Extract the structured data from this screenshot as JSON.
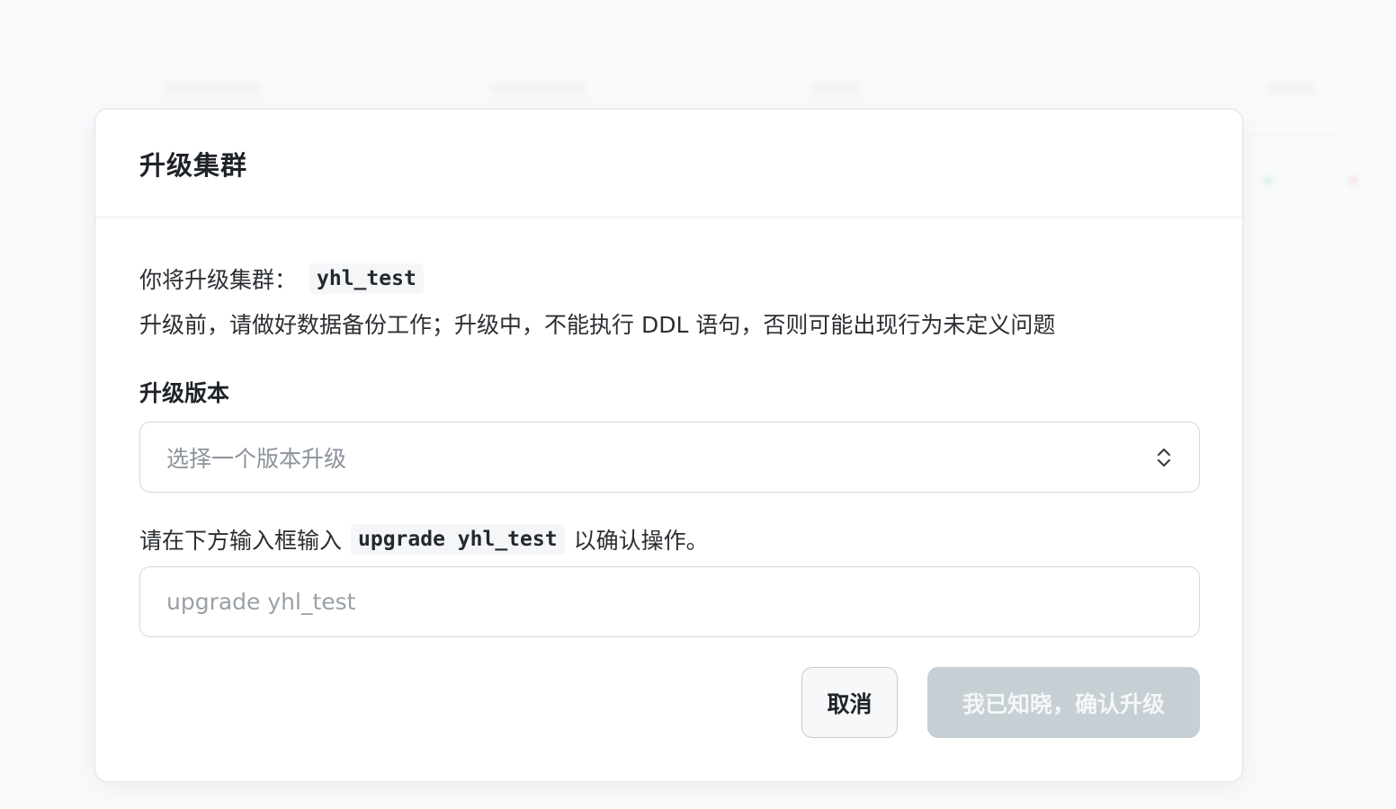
{
  "dialog": {
    "title": "升级集群",
    "intro_prefix": "你将升级集群：",
    "cluster_name": "yhl_test",
    "warning": "升级前，请做好数据备份工作；升级中，不能执行 DDL 语句，否则可能出现行为未定义问题",
    "version_label": "升级版本",
    "version_select": {
      "placeholder": "选择一个版本升级",
      "value": ""
    },
    "confirm_prompt_prefix": "请在下方输入框输入",
    "confirm_phrase": "upgrade yhl_test",
    "confirm_prompt_suffix": "以确认操作。",
    "confirm_input": {
      "placeholder": "upgrade yhl_test",
      "value": ""
    },
    "cancel_label": "取消",
    "confirm_label": "我已知晓，确认升级",
    "confirm_enabled": false
  },
  "icons": {
    "select_chevron": "chevron-up-down-icon"
  },
  "colors": {
    "confirm_disabled_bg": "#c6cfd4",
    "border": "#d3d8de",
    "placeholder": "#8c939b"
  }
}
